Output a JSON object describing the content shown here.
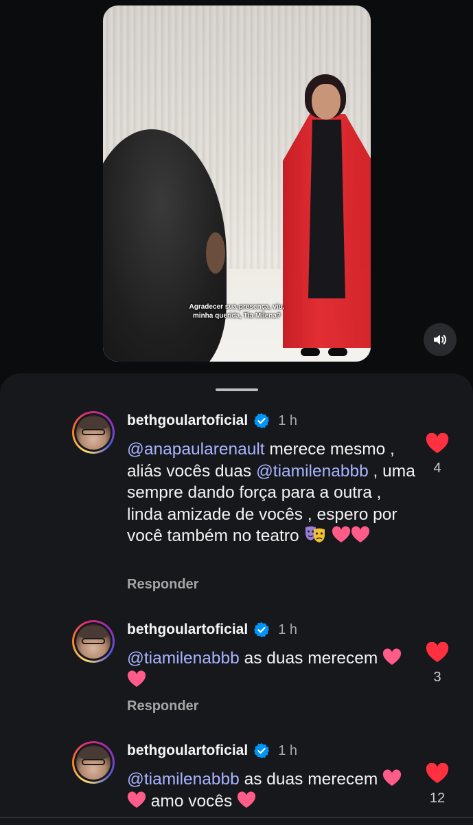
{
  "video": {
    "caption": "Agradecer sua presença, viu, minha querida, Tia Milena?",
    "sound_icon": "speaker-on-icon"
  },
  "comments": [
    {
      "username": "bethgoulartoficial",
      "time": "1 h",
      "mention1": "@anapaularenault",
      "part1": " merece mesmo , aliás vocês duas ",
      "mention2": "@tiamilenabbb",
      "part2": " , uma sempre dando força para a outra , linda amizade de vocês , espero por você também no teatro ",
      "emojis": [
        "performing-arts-icon",
        "heart-icon",
        "heart-icon"
      ],
      "reply": "Responder",
      "likes": "4"
    },
    {
      "username": "bethgoulartoficial",
      "time": "1 h",
      "mention1": "@tiamilenabbb",
      "part1": " as duas merecem ",
      "emojis": [
        "heart-icon",
        "heart-icon"
      ],
      "reply": "Responder",
      "likes": "3"
    },
    {
      "username": "bethgoulartoficial",
      "time": "1 h",
      "mention1": "@tiamilenabbb",
      "part1": " as duas merecem ",
      "part2": " amo vocês ",
      "emojis": [
        "heart-icon",
        "heart-icon",
        "heart-icon"
      ],
      "likes": "12"
    }
  ],
  "colors": {
    "mention": "#a9b4ff",
    "like_heart": "#ff3040",
    "verified": "#0095f6"
  }
}
